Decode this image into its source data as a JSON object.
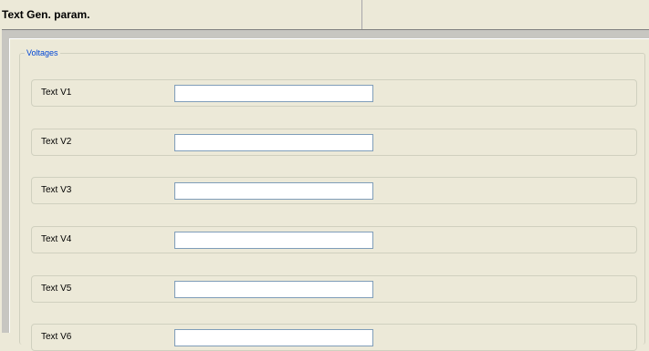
{
  "window": {
    "title": "Text Gen. param."
  },
  "group": {
    "label": "Voltages",
    "rows": [
      {
        "label": "Text V1",
        "value": ""
      },
      {
        "label": "Text V2",
        "value": ""
      },
      {
        "label": "Text V3",
        "value": ""
      },
      {
        "label": "Text V4",
        "value": ""
      },
      {
        "label": "Text V5",
        "value": ""
      },
      {
        "label": "Text V6",
        "value": ""
      }
    ]
  },
  "colors": {
    "background": "#ECE9D8",
    "group_label": "#0046D5",
    "input_border": "#7F9DB9",
    "frame_gray": "#C7C6C1"
  }
}
